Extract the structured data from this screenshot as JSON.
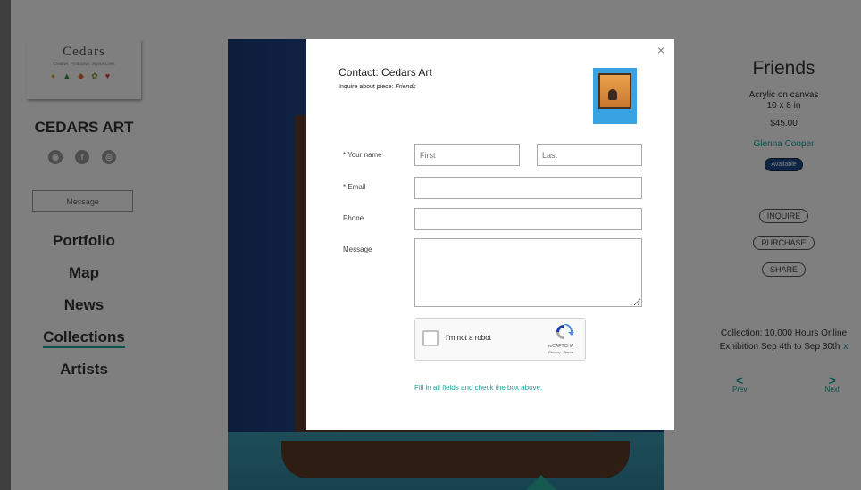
{
  "site": {
    "logo": {
      "title": "Cedars",
      "tagline": "Creative, Productive, Joyous Lives"
    },
    "name": "CEDARS ART",
    "social": [
      "web-icon",
      "facebook-icon",
      "instagram-icon"
    ],
    "message_button": "Message",
    "nav": [
      "Portfolio",
      "Map",
      "News",
      "Collections",
      "Artists"
    ],
    "active_nav": "Collections"
  },
  "artwork": {
    "title": "Friends",
    "medium": "Acrylic on canvas",
    "size": "10 x 8 in",
    "price": "$45.00",
    "artist": "Glenna Cooper",
    "status": "Available",
    "actions": {
      "inquire": "INQUIRE",
      "purchase": "PURCHASE",
      "share": "SHARE"
    },
    "collection_line1": "Collection: 10,000 Hours Online",
    "collection_line2": "Exhibition Sep 4th to Sep 30th",
    "collection_close": "x",
    "prev": "Prev",
    "next": "Next"
  },
  "modal": {
    "close": "×",
    "title": "Contact: Cedars Art",
    "subtitle_prefix": "Inquire about piece: ",
    "subtitle_piece": "Friends",
    "fields": {
      "name_label": "* Your name",
      "first_placeholder": "First",
      "last_placeholder": "Last",
      "email_label": "* Email",
      "phone_label": "Phone",
      "message_label": "Message"
    },
    "captcha": {
      "label": "I'm not a robot",
      "brand": "reCAPTCHA",
      "terms": "Privacy - Terms"
    },
    "hint": "Fill in all fields and check the box above."
  },
  "colors": {
    "accent": "#1aa39a",
    "badge": "#1d4a8a"
  }
}
